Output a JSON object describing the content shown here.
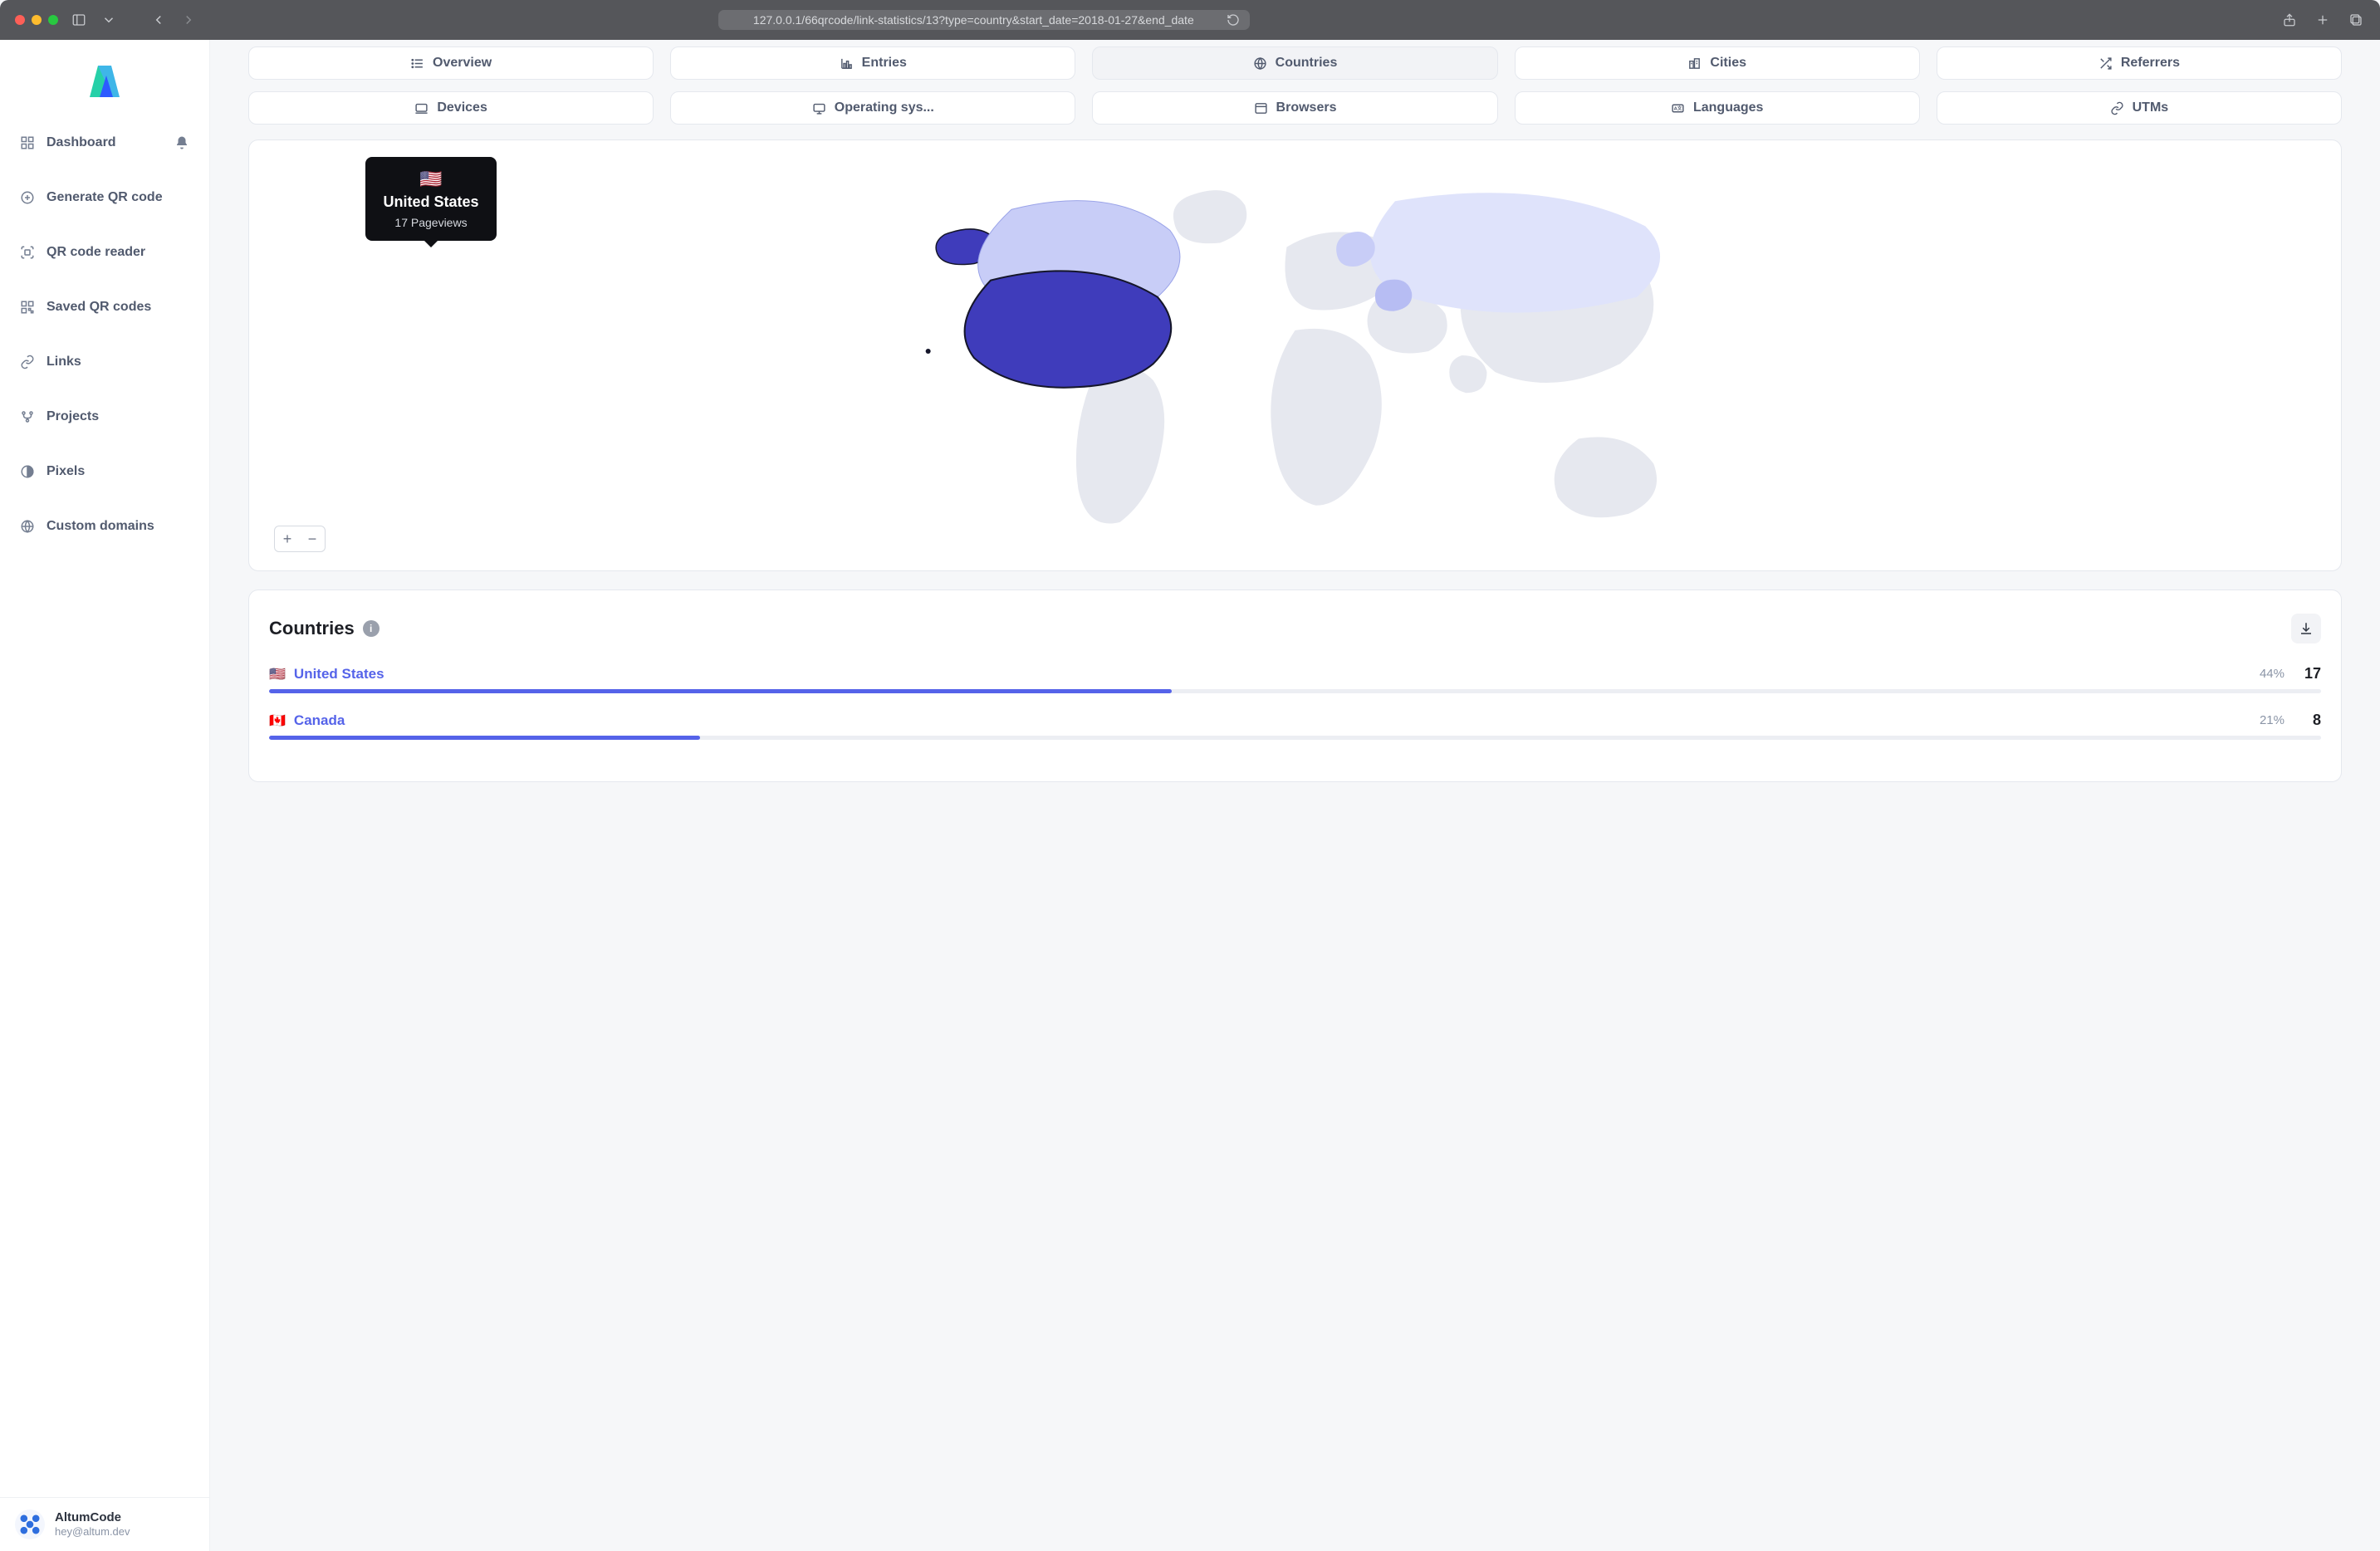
{
  "browser": {
    "url": "127.0.0.1/66qrcode/link-statistics/13?type=country&start_date=2018-01-27&end_date"
  },
  "sidebar": {
    "items": [
      {
        "label": "Dashboard",
        "icon": "grid-icon"
      },
      {
        "label": "Generate QR code",
        "icon": "plus-circle-icon"
      },
      {
        "label": "QR code reader",
        "icon": "scan-icon"
      },
      {
        "label": "Saved QR codes",
        "icon": "qrcode-icon"
      },
      {
        "label": "Links",
        "icon": "link-icon"
      },
      {
        "label": "Projects",
        "icon": "branch-icon"
      },
      {
        "label": "Pixels",
        "icon": "contrast-icon"
      },
      {
        "label": "Custom domains",
        "icon": "globe-icon"
      }
    ]
  },
  "account": {
    "name": "AltumCode",
    "email": "hey@altum.dev"
  },
  "tabs": {
    "row1": [
      {
        "label": "Overview",
        "icon": "list-icon"
      },
      {
        "label": "Entries",
        "icon": "chart-icon"
      },
      {
        "label": "Countries",
        "icon": "globe-icon",
        "active": true
      },
      {
        "label": "Cities",
        "icon": "city-icon"
      },
      {
        "label": "Referrers",
        "icon": "shuffle-icon"
      }
    ],
    "row2": [
      {
        "label": "Devices",
        "icon": "device-icon"
      },
      {
        "label": "Operating sys...",
        "icon": "os-icon"
      },
      {
        "label": "Browsers",
        "icon": "browser-icon"
      },
      {
        "label": "Languages",
        "icon": "lang-icon"
      },
      {
        "label": "UTMs",
        "icon": "link-icon"
      }
    ]
  },
  "map_tooltip": {
    "flag": "🇺🇸",
    "country": "United States",
    "pageviews": "17 Pageviews"
  },
  "country_list": {
    "title": "Countries",
    "rows": [
      {
        "flag": "🇺🇸",
        "name": "United States",
        "pct": "44%",
        "count": "17",
        "bar": 44
      },
      {
        "flag": "🇨🇦",
        "name": "Canada",
        "pct": "21%",
        "count": "8",
        "bar": 21
      }
    ]
  },
  "zoom": {
    "in": "+",
    "out": "−"
  },
  "colors": {
    "accent": "#5563e9",
    "map_base": "#e6e8ef",
    "map_mid": "#c8cdf7",
    "map_dark": "#3f3cbb"
  },
  "chart_data": {
    "type": "bar",
    "title": "Countries",
    "unit": "Pageviews",
    "categories": [
      "United States",
      "Canada"
    ],
    "values": [
      17,
      8
    ],
    "percentages": [
      44,
      21
    ]
  }
}
